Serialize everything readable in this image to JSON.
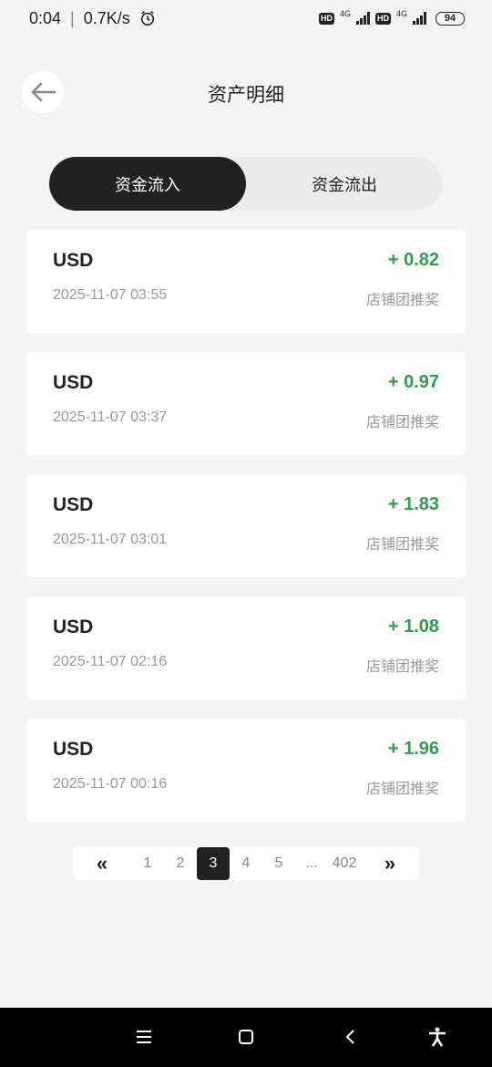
{
  "status_bar": {
    "time": "0:04",
    "speed": "0.7K/s",
    "battery": "94",
    "hd1": "HD",
    "hd2": "HD",
    "net1": "4G",
    "net2": "4G"
  },
  "header": {
    "title": "资产明细"
  },
  "tabs": [
    {
      "label": "资金流入",
      "active": true
    },
    {
      "label": "资金流出",
      "active": false
    }
  ],
  "records": [
    {
      "currency": "USD",
      "amount": "+ 0.82",
      "time": "2025-11-07 03:55",
      "type": "店铺团推奖"
    },
    {
      "currency": "USD",
      "amount": "+ 0.97",
      "time": "2025-11-07 03:37",
      "type": "店铺团推奖"
    },
    {
      "currency": "USD",
      "amount": "+ 1.83",
      "time": "2025-11-07 03:01",
      "type": "店铺团推奖"
    },
    {
      "currency": "USD",
      "amount": "+ 1.08",
      "time": "2025-11-07 02:16",
      "type": "店铺团推奖"
    },
    {
      "currency": "USD",
      "amount": "+ 1.96",
      "time": "2025-11-07 00:16",
      "type": "店铺团推奖"
    }
  ],
  "pagination": {
    "prev": "«",
    "next": "»",
    "pages": [
      "1",
      "2",
      "3",
      "4",
      "5",
      "...",
      "402"
    ],
    "current": "3"
  },
  "colors": {
    "accent": "#222222",
    "income": "#2e9d4f",
    "background": "#f4f4f4"
  }
}
